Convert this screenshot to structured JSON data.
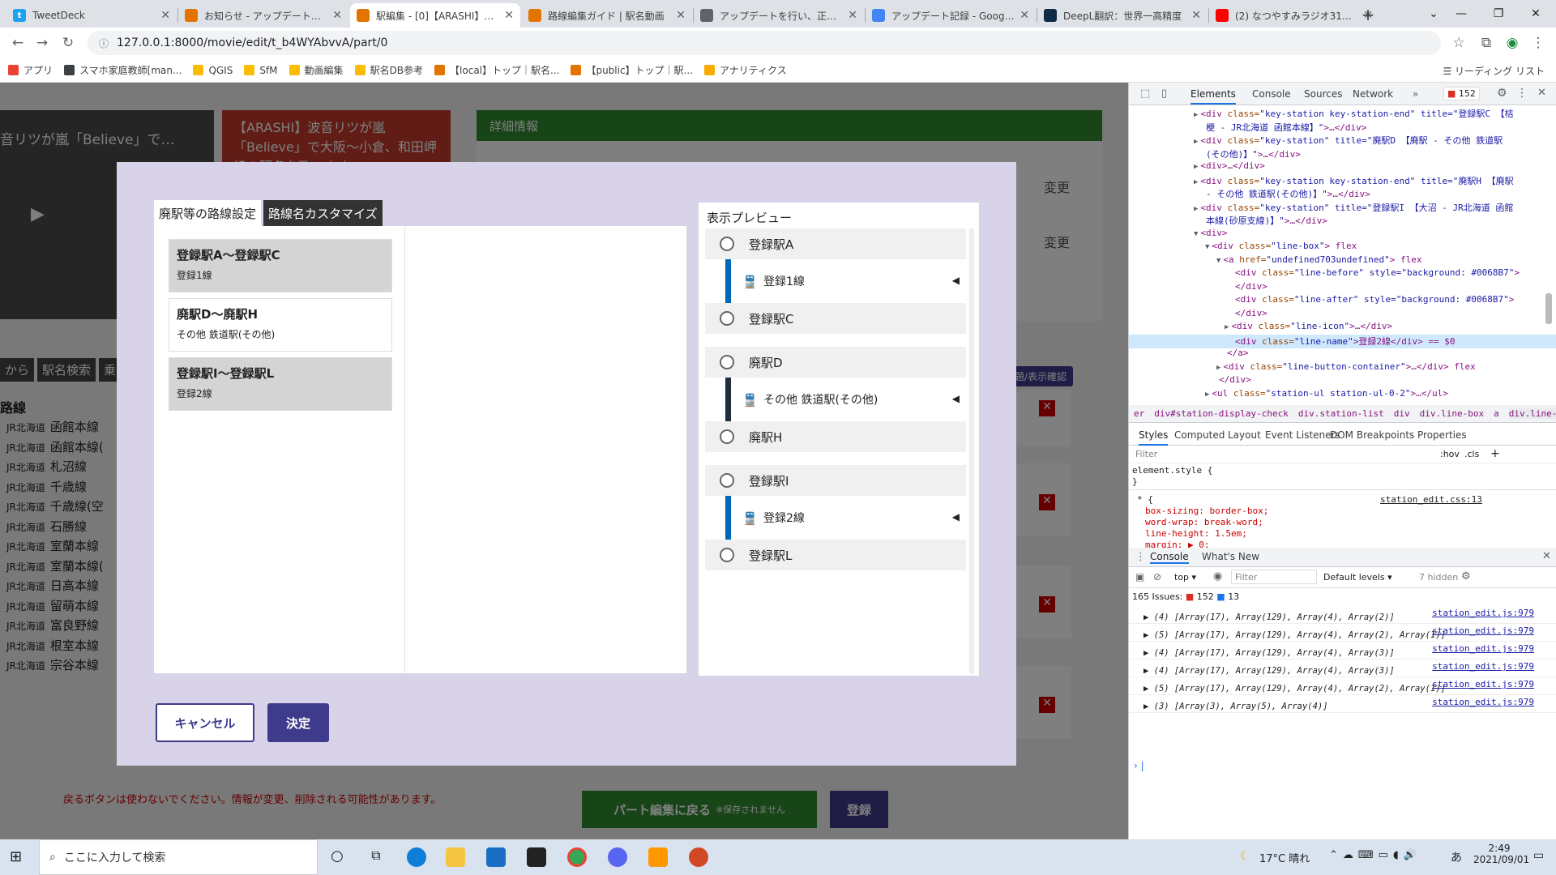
{
  "browser": {
    "tabs": [
      {
        "title": "TweetDeck",
        "favicon": "#1da1f2",
        "glyph": "t",
        "active": false
      },
      {
        "title": "お知らせ - アップデートを行いま",
        "favicon": "#e37400",
        "glyph": "",
        "active": false
      },
      {
        "title": "駅編集 - [0]【ARASHI】波音",
        "favicon": "#e37400",
        "glyph": "",
        "active": true
      },
      {
        "title": "路線編集ガイド | 駅名動画",
        "favicon": "#e37400",
        "glyph": "",
        "active": false
      },
      {
        "title": "アップデートを行い、正式に公開",
        "favicon": "#5f6368",
        "glyph": "",
        "active": false
      },
      {
        "title": "アップデート記録 - Google ド",
        "favicon": "#4285f4",
        "glyph": "",
        "active": false
      },
      {
        "title": "DeepL翻訳：世界一高精度",
        "favicon": "#0f2b46",
        "glyph": "",
        "active": false
      },
      {
        "title": "(2) なつやすみラジオ31日目",
        "favicon": "#ff0000",
        "glyph": "",
        "active": false
      }
    ],
    "url": "127.0.0.1:8000/movie/edit/t_b4WYAbvvA/part/0",
    "bookmarks": [
      {
        "label": "アプリ",
        "color": "#ea4335"
      },
      {
        "label": "スマホ家庭教師[man...",
        "color": "#3c4043"
      },
      {
        "label": "QGIS",
        "color": "#fbbc04"
      },
      {
        "label": "SfM",
        "color": "#fbbc04"
      },
      {
        "label": "動画編集",
        "color": "#fbbc04"
      },
      {
        "label": "駅名DB参考",
        "color": "#fbbc04"
      },
      {
        "label": "【local】トップ｜駅名...",
        "color": "#e37400"
      },
      {
        "label": "【public】トップ｜駅...",
        "color": "#e37400"
      },
      {
        "label": "アナリティクス",
        "color": "#f9ab00"
      }
    ],
    "reading_list": "リーディング リスト"
  },
  "background_page": {
    "video_title": "【ARASHI】波音リツが嵐「Believe」で大阪〜小倉、和田岬線の駅名を歌います",
    "video_overlay_text": "音リツが嵐「Believe」で…",
    "details_header": "詳細情報",
    "change_label": "変更",
    "search_tabs": [
      "から",
      "駅名検索",
      "乗"
    ],
    "route_label": "路線",
    "confirm_label": "題/表示確認",
    "routes": [
      {
        "company": "JR北海道",
        "name": "函館本線"
      },
      {
        "company": "JR北海道",
        "name": "函館本線("
      },
      {
        "company": "JR北海道",
        "name": "札沼線"
      },
      {
        "company": "JR北海道",
        "name": "千歳線"
      },
      {
        "company": "JR北海道",
        "name": "千歳線(空"
      },
      {
        "company": "JR北海道",
        "name": "石勝線"
      },
      {
        "company": "JR北海道",
        "name": "室蘭本線"
      },
      {
        "company": "JR北海道",
        "name": "室蘭本線("
      },
      {
        "company": "JR北海道",
        "name": "日高本線"
      },
      {
        "company": "JR北海道",
        "name": "留萌本線"
      },
      {
        "company": "JR北海道",
        "name": "富良野線"
      },
      {
        "company": "JR北海道",
        "name": "根室本線"
      },
      {
        "company": "JR北海道",
        "name": "宗谷本線"
      }
    ],
    "warning": "戻るボタンは使わないでください。情報が変更、削除される可能性があります。",
    "back_button": "パート編集に戻る",
    "back_note": "※保存されません",
    "register_button": "登録"
  },
  "modal": {
    "tabs": [
      "廃駅等の路線設定",
      "路線名カスタマイズ"
    ],
    "line_items": [
      {
        "name": "登録駅A〜登録駅C",
        "sub": "登録1線",
        "style": "gray"
      },
      {
        "name": "廃駅D〜廃駅H",
        "sub": "その他 鉄道駅(その他)",
        "style": "white"
      },
      {
        "name": "登録駅I〜登録駅L",
        "sub": "登録2線",
        "style": "gray"
      }
    ],
    "preview_title": "表示プレビュー",
    "preview_groups": [
      {
        "start": "登録駅A",
        "line": "登録1線",
        "end": "登録駅C",
        "color": "#0068b7"
      },
      {
        "start": "廃駅D",
        "line": "その他 鉄道駅(その他)",
        "end": "廃駅H",
        "color": "#1e2e3c"
      },
      {
        "start": "登録駅I",
        "line": "登録2線",
        "end": "登録駅L",
        "color": "#0068b7"
      }
    ],
    "train_icon": "🚆",
    "arrow": "◀",
    "cancel": "キャンセル",
    "ok": "決定"
  },
  "devtools": {
    "tabs": [
      "Elements",
      "Console",
      "Sources",
      "Network"
    ],
    "issues_badge": "152",
    "elements": [
      {
        "indent": 80,
        "arrow": "▶",
        "tag": "<div ",
        "attr": "class=",
        "val": "\"key-station key-station-end\" title=\"登録駅C 【桔",
        "rest": "",
        "hl": false
      },
      {
        "indent": 92,
        "arrow": "",
        "tag": "",
        "attr": "",
        "val": "梗 - JR北海道 函館本線】\"",
        "rest": ">…</div>",
        "hl": false
      },
      {
        "indent": 80,
        "arrow": "▶",
        "tag": "<div ",
        "attr": "class=",
        "val": "\"key-station\" title=\"廃駅D 【廃駅 - その他 鉄道駅",
        "rest": "",
        "hl": false
      },
      {
        "indent": 92,
        "arrow": "",
        "tag": "",
        "attr": "",
        "val": "(その他)】\"",
        "rest": ">…</div>",
        "hl": false
      },
      {
        "indent": 80,
        "arrow": "▶",
        "tag": "<div>…</div>",
        "attr": "",
        "val": "",
        "rest": "",
        "hl": false
      },
      {
        "indent": 80,
        "arrow": "▶",
        "tag": "<div ",
        "attr": "class=",
        "val": "\"key-station key-station-end\" title=\"廃駅H 【廃駅",
        "rest": "",
        "hl": false
      },
      {
        "indent": 92,
        "arrow": "",
        "tag": "",
        "attr": "",
        "val": "- その他 鉄道駅(その他)】\"",
        "rest": ">…</div>",
        "hl": false
      },
      {
        "indent": 80,
        "arrow": "▶",
        "tag": "<div ",
        "attr": "class=",
        "val": "\"key-station\" title=\"登録駅I 【大沼 - JR北海道 函館",
        "rest": "",
        "hl": false
      },
      {
        "indent": 92,
        "arrow": "",
        "tag": "",
        "attr": "",
        "val": "本線(砂原支線)】\"",
        "rest": ">…</div>",
        "hl": false
      },
      {
        "indent": 80,
        "arrow": "▼",
        "tag": "<div>",
        "attr": "",
        "val": "",
        "rest": "",
        "hl": false
      },
      {
        "indent": 94,
        "arrow": "▼",
        "tag": "<div ",
        "attr": "class=",
        "val": "\"line-box\"",
        "rest": "> flex",
        "hl": false
      },
      {
        "indent": 108,
        "arrow": "▼",
        "tag": "<a ",
        "attr": "href=",
        "val": "\"undefined703undefined\"",
        "rest": "> flex",
        "hl": false
      },
      {
        "indent": 128,
        "arrow": "",
        "tag": "<div ",
        "attr": "class=",
        "val": "\"line-before\" style=\"background: #0068B7\"",
        "rest": ">",
        "hl": false
      },
      {
        "indent": 128,
        "arrow": "",
        "tag": "</div>",
        "attr": "",
        "val": "",
        "rest": "",
        "hl": false
      },
      {
        "indent": 128,
        "arrow": "",
        "tag": "<div ",
        "attr": "class=",
        "val": "\"line-after\" style=\"background: #0068B7\"",
        "rest": ">",
        "hl": false
      },
      {
        "indent": 128,
        "arrow": "",
        "tag": "</div>",
        "attr": "",
        "val": "",
        "rest": "",
        "hl": false
      },
      {
        "indent": 118,
        "arrow": "▶",
        "tag": "<div ",
        "attr": "class=",
        "val": "\"line-icon\"",
        "rest": ">…</div>",
        "hl": false
      },
      {
        "indent": 128,
        "arrow": "",
        "tag": "<div ",
        "attr": "class=",
        "val": "\"line-name\"",
        "rest": ">登録2線</div> == $0",
        "hl": true
      },
      {
        "indent": 118,
        "arrow": "",
        "tag": "</a>",
        "attr": "",
        "val": "",
        "rest": "",
        "hl": false
      },
      {
        "indent": 108,
        "arrow": "▶",
        "tag": "<div ",
        "attr": "class=",
        "val": "\"line-button-container\"",
        "rest": ">…</div> flex",
        "hl": false
      },
      {
        "indent": 108,
        "arrow": "",
        "tag": "</div>",
        "attr": "",
        "val": "",
        "rest": "",
        "hl": false
      },
      {
        "indent": 94,
        "arrow": "▶",
        "tag": "<ul ",
        "attr": "class=",
        "val": "\"station-ul station-ul-0-2\"",
        "rest": ">…</ul>",
        "hl": false
      }
    ],
    "breadcrumb": [
      "er",
      "div#station-display-check",
      "div.station-list",
      "div",
      "div.line-box",
      "a",
      "div.line-name"
    ],
    "style_tabs": [
      "Styles",
      "Computed",
      "Layout",
      "Event Listeners",
      "DOM Breakpoints",
      "Properties"
    ],
    "filter_placeholder": "Filter",
    "hov": ":hov",
    "cls": ".cls",
    "element_style": "element.style {",
    "element_style_close": "}",
    "rule_selector": "* {",
    "rule_source": "station_edit.css:13",
    "rule_props": [
      "box-sizing: border-box;",
      "word-wrap: break-word;",
      "line-height: 1.5em;",
      "margin: ▶ 0;",
      "padding: ▶ 0;"
    ],
    "drawer_tabs": [
      "Console",
      "What's New"
    ],
    "context": "top",
    "console_filter": "Filter",
    "default_levels": "Default levels",
    "hidden": "7 hidden",
    "issues_line": "165 Issues:",
    "issues_red": "152",
    "issues_blue": "13",
    "console_lines": [
      {
        "text": "▶ (4) [Array(17), Array(129), Array(4), Array(2)]",
        "src": "station_edit.js:979"
      },
      {
        "text": "▶ (5) [Array(17), Array(129), Array(4), Array(2), Array(1)]",
        "src": "station_edit.js:979"
      },
      {
        "text": "▶ (4) [Array(17), Array(129), Array(4), Array(3)]",
        "src": "station_edit.js:979"
      },
      {
        "text": "▶ (4) [Array(17), Array(129), Array(4), Array(3)]",
        "src": "station_edit.js:979"
      },
      {
        "text": "▶ (5) [Array(17), Array(129), Array(4), Array(2), Array(1)]",
        "src": "station_edit.js:979"
      },
      {
        "text": "▶ (3) [Array(3), Array(5), Array(4)]",
        "src": "station_edit.js:979"
      }
    ]
  },
  "taskbar": {
    "search_placeholder": "ここに入力して検索",
    "weather": "17°C 晴れ",
    "time": "2:49",
    "date": "2021/09/01",
    "ime": "あ"
  }
}
